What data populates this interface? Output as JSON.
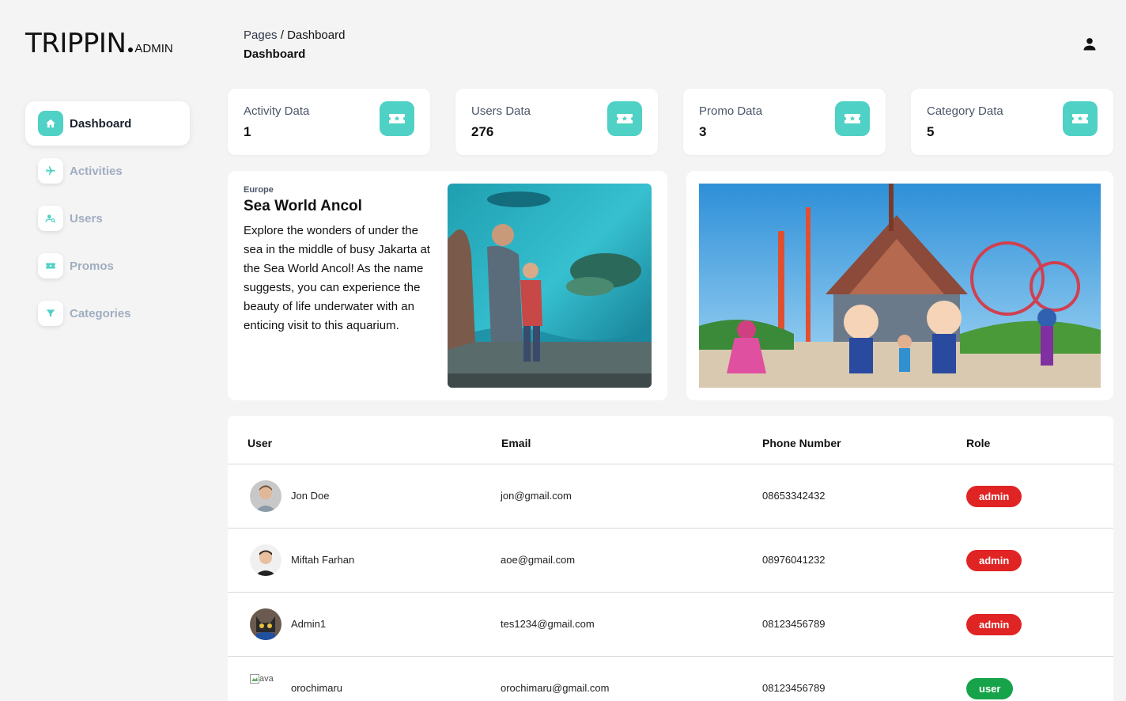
{
  "brand": {
    "main": "TRIPPIN",
    "sub": "ADMIN"
  },
  "nav": {
    "items": [
      {
        "label": "Dashboard",
        "icon": "home-icon"
      },
      {
        "label": "Activities",
        "icon": "plane-icon"
      },
      {
        "label": "Users",
        "icon": "user-search-icon"
      },
      {
        "label": "Promos",
        "icon": "ticket-icon"
      },
      {
        "label": "Categories",
        "icon": "filter-icon"
      }
    ]
  },
  "header": {
    "crumb_root": "Pages",
    "crumb_sep": "/",
    "crumb_current": "Dashboard",
    "title": "Dashboard"
  },
  "stats": [
    {
      "label": "Activity Data",
      "value": "1"
    },
    {
      "label": "Users Data",
      "value": "276"
    },
    {
      "label": "Promo Data",
      "value": "3"
    },
    {
      "label": "Category Data",
      "value": "5"
    }
  ],
  "feature": {
    "region": "Europe",
    "title": "Sea World Ancol",
    "description": "Explore the wonders of under the sea in the middle of busy Jakarta at the Sea World Ancol! As the name suggests, you can experience the beauty of life underwater with an enticing visit to this aquarium."
  },
  "table": {
    "headers": [
      "User",
      "Email",
      "Phone Number",
      "Role"
    ],
    "rows": [
      {
        "name": "Jon Doe",
        "email": "jon@gmail.com",
        "phone": "08653342432",
        "role": "admin"
      },
      {
        "name": "Miftah Farhan",
        "email": "aoe@gmail.com",
        "phone": "08976041232",
        "role": "admin"
      },
      {
        "name": "Admin1",
        "email": "tes1234@gmail.com",
        "phone": "08123456789",
        "role": "admin"
      },
      {
        "name": "orochimaru",
        "email": "orochimaru@gmail.com",
        "phone": "08123456789",
        "role": "user",
        "avatar_alt": "ava"
      }
    ]
  },
  "colors": {
    "accent": "#4fd1c5",
    "admin": "#e02424",
    "user": "#16a34a"
  }
}
